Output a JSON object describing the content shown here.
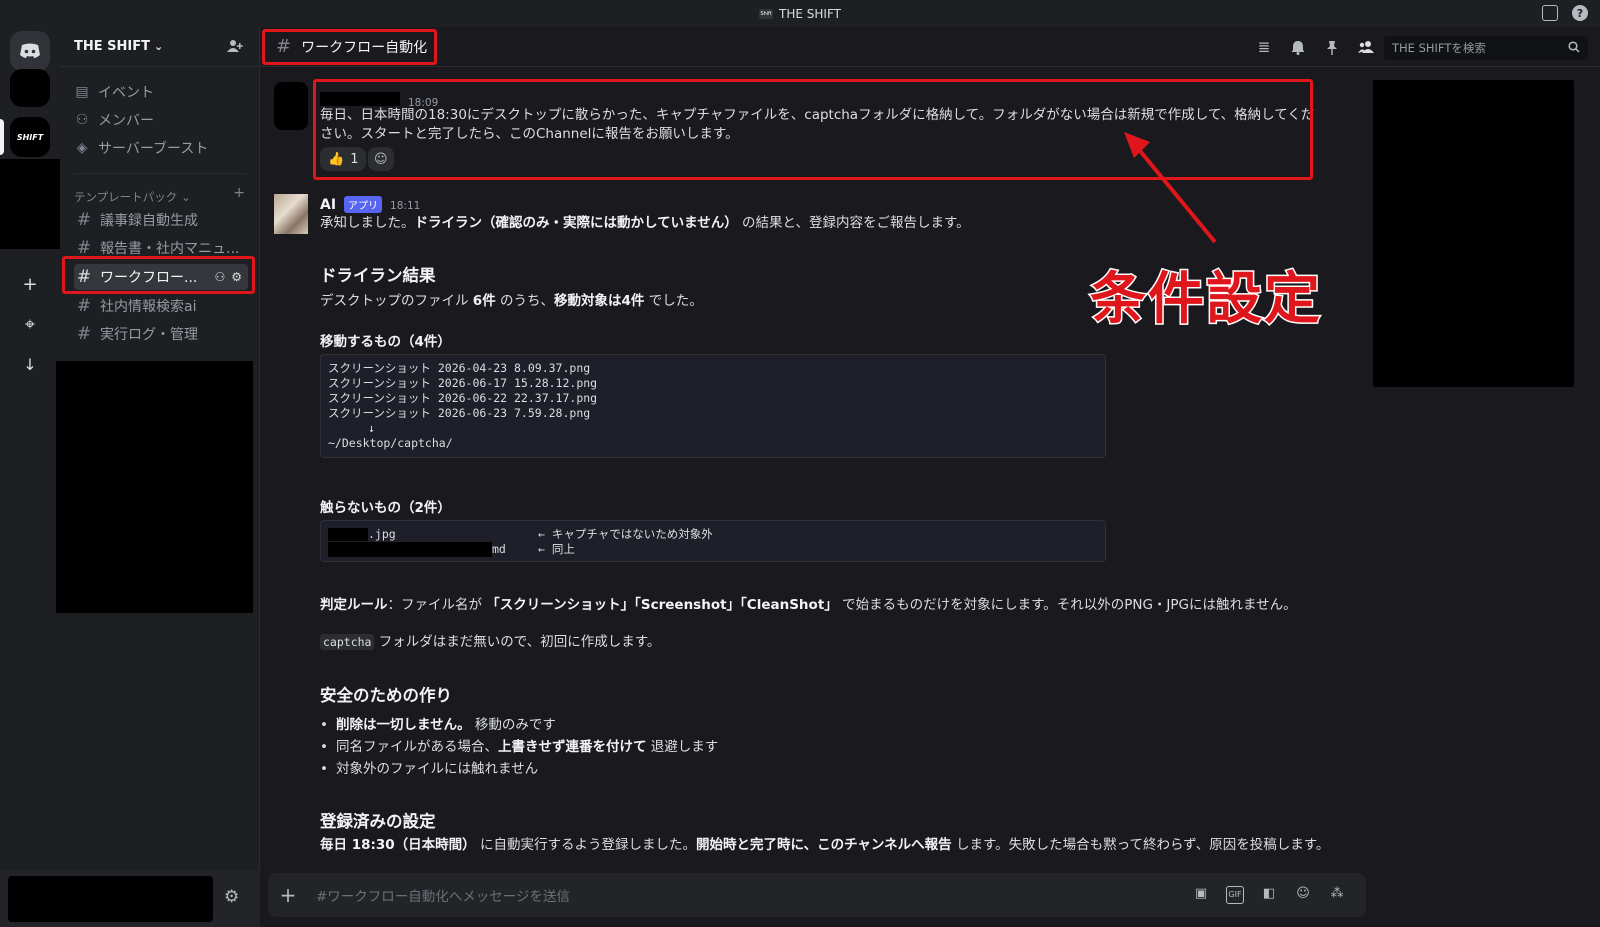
{
  "titlebar": {
    "title": "THE SHIFT",
    "server_mini": "Shift",
    "help": "?"
  },
  "rail": {
    "server_label": "SHIFT",
    "add": "+",
    "explore": "⌖",
    "download": "↓"
  },
  "sidebar": {
    "server_name": "THE SHIFT",
    "chevron": "⌄",
    "top_items": [
      {
        "label": "イベント"
      },
      {
        "label": "メンバー"
      },
      {
        "label": "サーバーブースト"
      }
    ],
    "category": {
      "label": "テンプレートパック",
      "chevron": "⌄",
      "add": "+"
    },
    "channels": [
      {
        "label": "議事録自動生成"
      },
      {
        "label": "報告書・社内マニュ..."
      },
      {
        "label": "ワークフロー..."
      },
      {
        "label": "社内情報検索ai"
      },
      {
        "label": "実行ログ・管理"
      }
    ],
    "hash": "#"
  },
  "header": {
    "channel_name": "ワークフロー自動化",
    "search_placeholder": "THE SHIFTを検索"
  },
  "messages": [
    {
      "time": "18:09",
      "text": "毎日、日本時間の18:30にデスクトップに散らかった、キャプチャファイルを、captchaフォルダに格納して。フォルダがない場合は新規で作成して、格納してください。スタートと完了したら、このChannelに報告をお願いします。",
      "reaction_count": "1"
    },
    {
      "username": "AI",
      "badge": "アプリ",
      "time": "18:11",
      "intro_a": "承知しました。",
      "intro_b": "ドライラン（確認のみ・実際には動かしていません）",
      "intro_c": " の結果と、登録内容をご報告します。",
      "h_dryrun": "ドライラン結果",
      "summary_a": "デスクトップのファイル ",
      "summary_b": "6件",
      "summary_c": " のうち、",
      "summary_d": "移動対象は4件",
      "summary_e": " でした。",
      "h_move": "移動するもの（4件）",
      "move_files": [
        "スクリーンショット 2026-04-23 8.09.37.png",
        "スクリーンショット 2026-06-17 15.28.12.png",
        "スクリーンショット 2026-06-22 22.37.17.png",
        "スクリーンショット 2026-06-23 7.59.28.png"
      ],
      "move_arrow": "↓",
      "move_dest": "~/Desktop/captcha/",
      "h_keep": "触らないもの（2件）",
      "keep_1_ext": ".jpg",
      "keep_1_note": "← キャプチャではないため対象外",
      "keep_2_ext": "md",
      "keep_2_note": "← 同上",
      "rule_label": "判定ルール",
      "rule_a": "：ファイル名が ",
      "rule_b": "「スクリーンショット」「Screenshot」「CleanShot」",
      "rule_c": " で始まるものだけを対象にします。それ以外のPNG・JPGには触れません。",
      "captcha_code": "captcha",
      "captcha_rest": " フォルダはまだ無いので、初回に作成します。",
      "h_safety": "安全のための作り",
      "bullet_1a": "削除は一切しません。",
      "bullet_1b": " 移動のみです",
      "bullet_2a": "同名ファイルがある場合、",
      "bullet_2b": "上書きせず連番を付けて",
      "bullet_2c": " 退避します",
      "bullet_3": "対象外のファイルには触れません",
      "h_registered": "登録済みの設定",
      "reg_a": "毎日 18:30（日本時間）",
      "reg_b": " に自動実行するよう登録しました。",
      "reg_c": "開始時と完了時に、このチャンネルへ報告",
      "reg_d": " します。失敗した場合も黙って終わらず、原因を投稿します。"
    }
  ],
  "callout": {
    "label": "条件設定"
  },
  "composer": {
    "placeholder": "#ワークフロー自動化へメッセージを送信",
    "plus": "+",
    "gif": "GIF"
  },
  "colors": {
    "highlight": "#e0161d",
    "accent": "#5865f2"
  }
}
